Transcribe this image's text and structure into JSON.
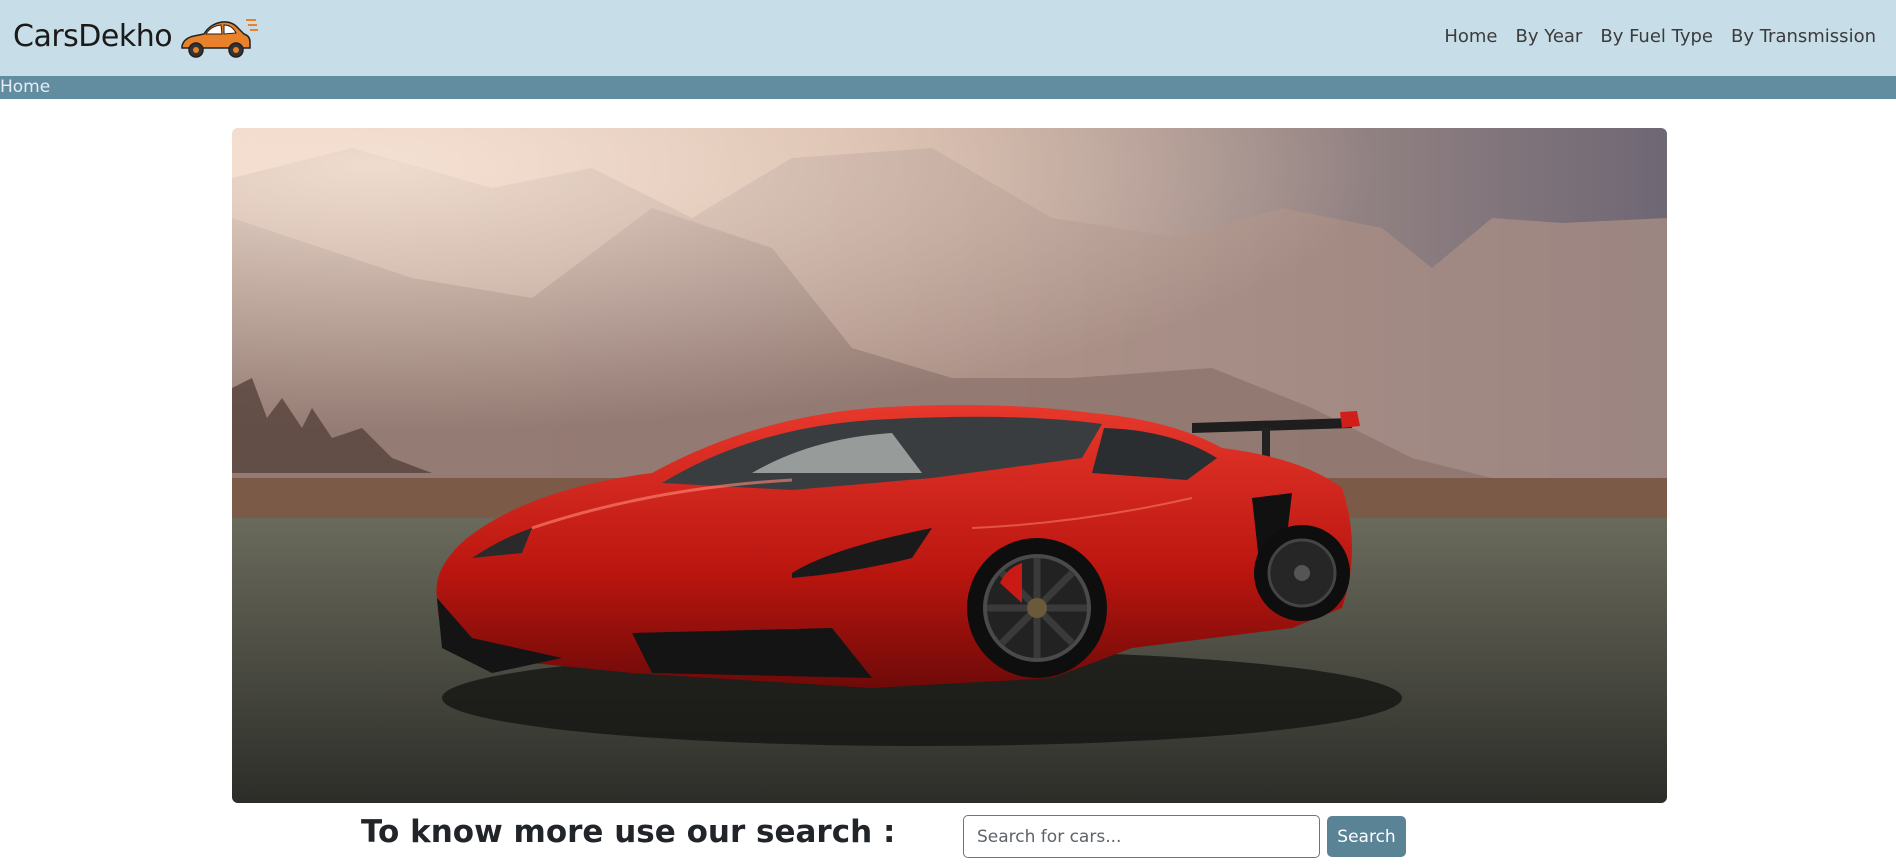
{
  "brand": {
    "name": "CarsDekho",
    "logo_icon": "car-logo-icon"
  },
  "nav": {
    "items": [
      {
        "label": "Home"
      },
      {
        "label": "By Year"
      },
      {
        "label": "By Fuel Type"
      },
      {
        "label": "By Transmission"
      }
    ]
  },
  "breadcrumb": {
    "current": "Home"
  },
  "hero": {
    "image": "red-sports-car-photo"
  },
  "search": {
    "heading": "To know more use our search :",
    "placeholder": "Search for cars...",
    "value": "",
    "button_label": "Search"
  },
  "colors": {
    "navbar_bg": "#c7dde8",
    "breadcrumb_bg": "#628ca0",
    "button_bg": "#5a8396",
    "logo_orange": "#e8812a"
  }
}
